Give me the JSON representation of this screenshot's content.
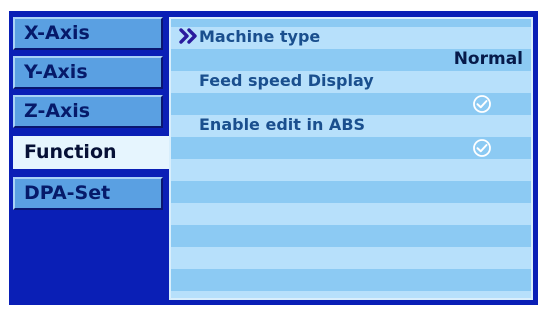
{
  "sidebar": {
    "items": [
      {
        "label": "X-Axis",
        "active": false
      },
      {
        "label": "Y-Axis",
        "active": false
      },
      {
        "label": "Z-Axis",
        "active": false
      },
      {
        "label": "Function",
        "active": true
      },
      {
        "label": "DPA-Set",
        "active": false
      }
    ]
  },
  "panel": {
    "rows": [
      {
        "label": "Machine type",
        "value": "Normal",
        "selected": true
      },
      {
        "label": "Feed speed Display",
        "checked": true
      },
      {
        "label": "Enable edit in ABS",
        "checked": true
      }
    ]
  },
  "colors": {
    "screen_bg": "#0a1fb6",
    "panel_bg": "#8ccaf3",
    "stripe": "#b7e0fb",
    "tab_inactive": "#5aa0e2",
    "tab_active": "#e6f5fe",
    "label_text": "#1a4f8e",
    "selection_marker": "#2a1a9e"
  },
  "icons": {
    "selection_marker": "double-chevron-right-icon",
    "checkmark": "check-circle-icon"
  }
}
